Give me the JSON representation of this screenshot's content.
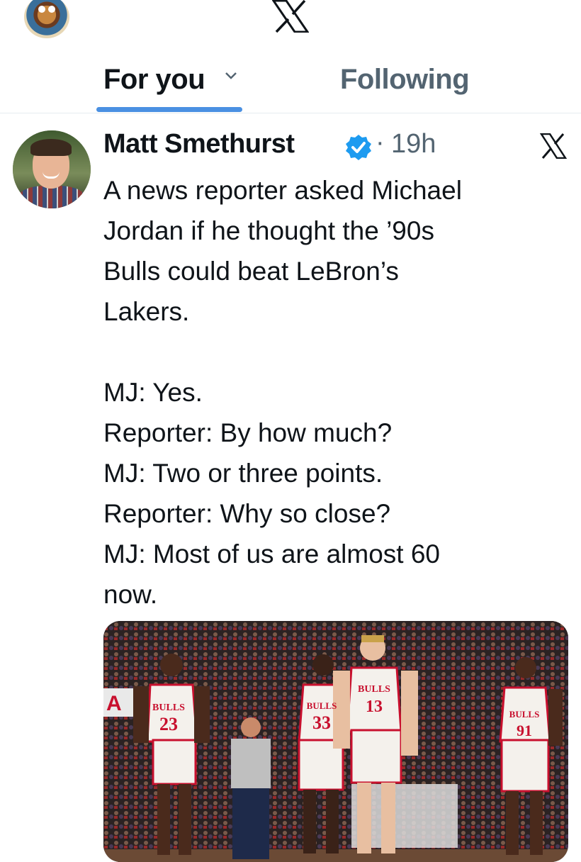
{
  "header": {
    "logo_icon": "x-logo-icon"
  },
  "tabs": [
    {
      "label": "For you",
      "active": true
    },
    {
      "label": "Following",
      "active": false
    }
  ],
  "tweet": {
    "author": "Matt Smethurst",
    "verified_icon": "verified-badge-icon",
    "separator": "·",
    "time": "19h",
    "lines_1": [
      "A news reporter asked Michael",
      "Jordan if he thought the ’90s",
      "Bulls could beat LeBron’s",
      "Lakers."
    ],
    "lines_2": [
      "MJ: Yes.",
      "Reporter: By how much?",
      "MJ: Two or three points.",
      "Reporter: Why so close?",
      "MJ: Most of us are almost 60",
      "now."
    ],
    "media": {
      "jerseys": [
        {
          "team": "BULLS",
          "number": "23"
        },
        {
          "team": "BULLS",
          "number": "33"
        },
        {
          "team": "BULLS",
          "number": "13"
        },
        {
          "team": "BULLS",
          "number": "91"
        }
      ]
    }
  },
  "colors": {
    "accent": "#4a90e2",
    "secondary_text": "#536471",
    "verified": "#1d9bf0",
    "bulls_red": "#c8102e"
  }
}
